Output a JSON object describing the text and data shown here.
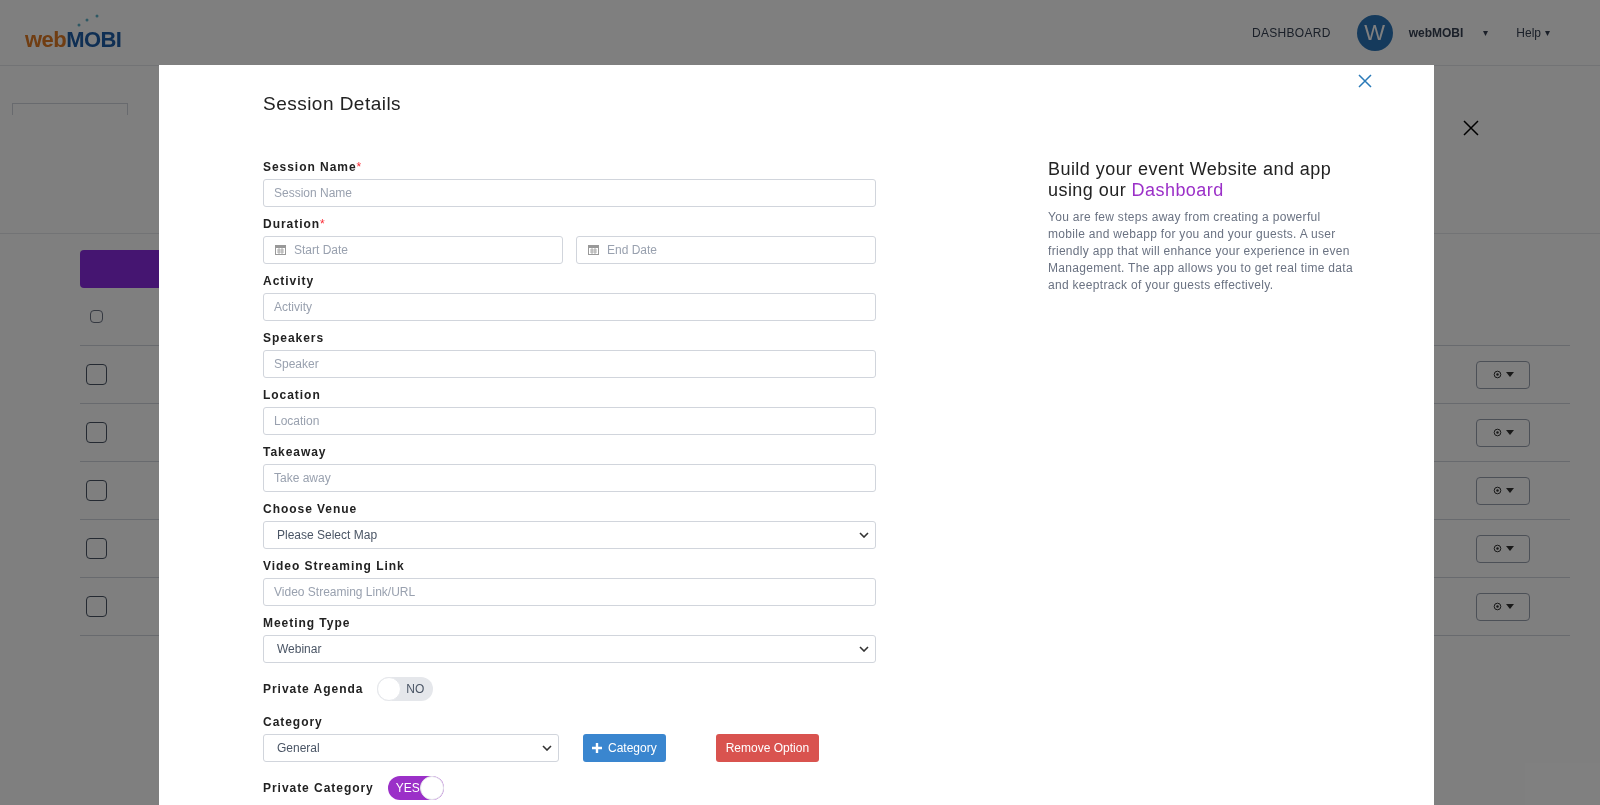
{
  "header": {
    "logo": {
      "first": "web",
      "second": "MOBI"
    },
    "nav": [
      {
        "kind": "link",
        "label": "DASHBOARD"
      },
      {
        "kind": "user",
        "avatar": "W",
        "label": "webMOBI",
        "caret": "▾"
      },
      {
        "kind": "menu",
        "label": "Help",
        "caret": "▾"
      }
    ]
  },
  "background_table": {
    "select_all": {
      "checked": false
    },
    "rows": [
      {
        "checked": false
      },
      {
        "checked": false
      },
      {
        "checked": false
      },
      {
        "checked": false
      },
      {
        "checked": false
      }
    ]
  },
  "modal": {
    "title": "Session Details",
    "fields": [
      {
        "kind": "text",
        "label": "Session Name",
        "required_mark": "*",
        "placeholder": "Session Name"
      },
      {
        "kind": "dates",
        "label": "Duration",
        "required_mark": "*",
        "start_placeholder": "Start Date",
        "end_placeholder": "End Date"
      },
      {
        "kind": "text",
        "label": "Activity",
        "placeholder": "Activity"
      },
      {
        "kind": "text",
        "label": "Speakers",
        "placeholder": "Speaker"
      },
      {
        "kind": "text",
        "label": "Location",
        "placeholder": "Location"
      },
      {
        "kind": "text",
        "label": "Takeaway",
        "placeholder": "Take away"
      },
      {
        "kind": "select",
        "label": "Choose Venue",
        "value": "Please Select Map"
      },
      {
        "kind": "text",
        "label": "Video Streaming Link",
        "placeholder": "Video Streaming Link/URL"
      },
      {
        "kind": "select",
        "label": "Meeting Type",
        "value": "Webinar"
      },
      {
        "kind": "toggle",
        "label": "Private Agenda",
        "on": false,
        "text": "NO"
      },
      {
        "kind": "category",
        "label": "Category",
        "value": "General",
        "add_button": "Category",
        "remove_button": "Remove Option"
      },
      {
        "kind": "toggle",
        "label": "Private Category",
        "on": true,
        "text": "YES"
      }
    ],
    "promo": {
      "heading": "Build your event Website and app using our",
      "heading_link": "Dashboard",
      "body": "You are few steps away from creating a powerful mobile and webapp for you and your guests. A user friendly app that will enhance your experience in even Management. The app allows you to get real time data and keeptrack of your guests effectively."
    }
  }
}
